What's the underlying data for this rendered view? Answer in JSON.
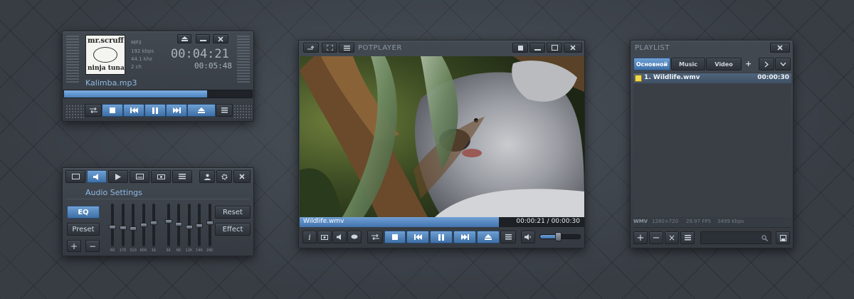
{
  "mini_player": {
    "album_art": {
      "line1": "mr.scruff",
      "line2": "ninja tuna"
    },
    "codec": "MP3",
    "bitrate": "192 kbps",
    "samplerate": "44.1 khz",
    "channels": "2 ch",
    "elapsed": "00:04:21",
    "remaining": "00:05:48",
    "filename": "Kalimba.mp3",
    "progress": 0.76
  },
  "audio_panel": {
    "title": "Audio Settings",
    "eq_label": "EQ",
    "preset_label": "Preset",
    "reset_label": "Reset",
    "effect_label": "Effect",
    "plus_label": "+",
    "minus_label": "−",
    "bands": [
      {
        "freq": "60",
        "level": 0.45
      },
      {
        "freq": "170",
        "level": 0.42
      },
      {
        "freq": "310",
        "level": 0.4
      },
      {
        "freq": "600",
        "level": 0.5
      },
      {
        "freq": "1K",
        "level": 0.55
      },
      {
        "freq": "3K",
        "level": 0.6
      },
      {
        "freq": "6K",
        "level": 0.52
      },
      {
        "freq": "12K",
        "level": 0.45
      },
      {
        "freq": "14K",
        "level": 0.48
      },
      {
        "freq": "16K",
        "level": 0.55
      }
    ]
  },
  "main_player": {
    "title": "POTPLAYER",
    "filename": "Wildlife.wmv",
    "time": "00:00:21 / 00:00:30",
    "progress": 0.7,
    "volume": 0.45,
    "info_label": "i"
  },
  "playlist": {
    "title": "PLAYLIST",
    "tabs": [
      {
        "label": "Основной",
        "active": true
      },
      {
        "label": "Music",
        "active": false
      },
      {
        "label": "Video",
        "active": false
      }
    ],
    "add_tab_label": "+",
    "items": [
      {
        "label": "1. Wildlife.wmv",
        "duration": "00:00:30"
      }
    ],
    "info": {
      "format": "WMV",
      "resolution": "1280×720",
      "fps": "29.97 FPS",
      "bitrate": "3499 Kbps"
    },
    "search_placeholder": "",
    "add_label": "+",
    "remove_label": "−",
    "clear_label": "×"
  },
  "colors": {
    "accent": "#4f86c6",
    "window": "#3a3f46",
    "background": "#383d44"
  }
}
